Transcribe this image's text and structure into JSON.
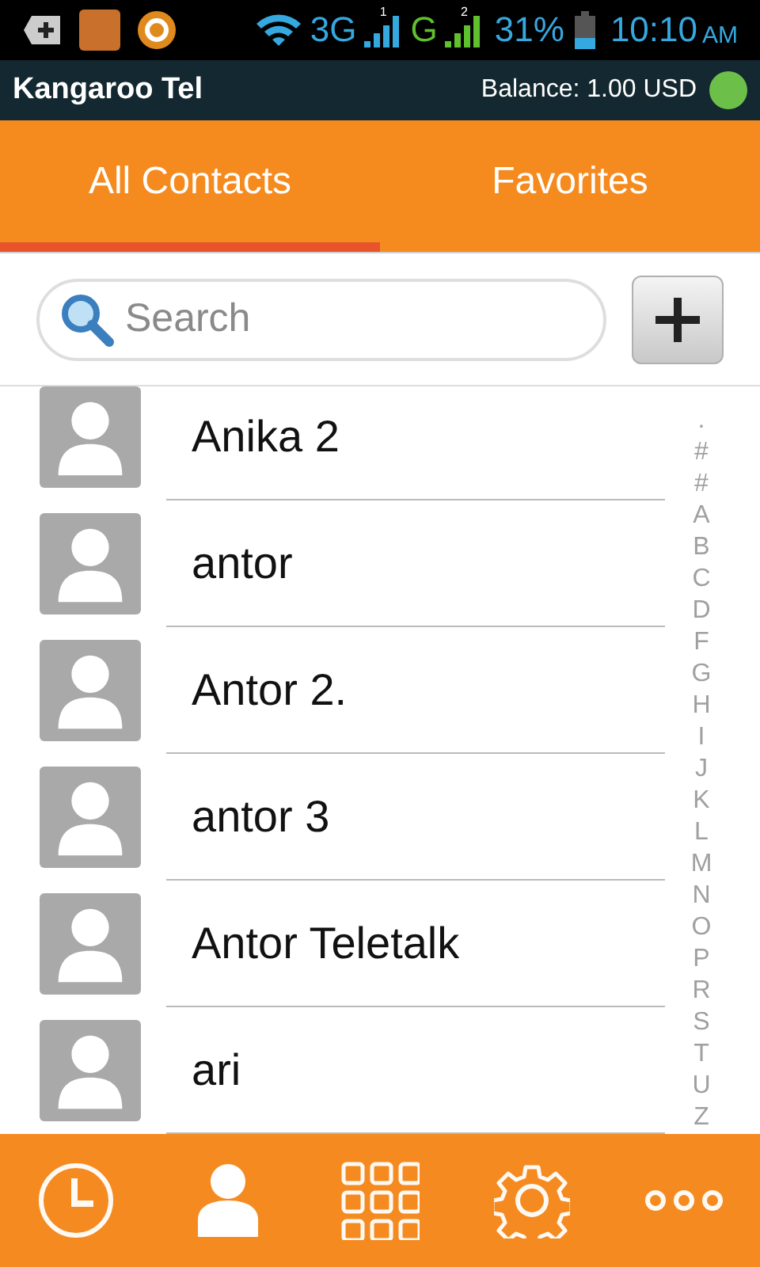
{
  "status_bar": {
    "network_1": "3G",
    "sim_1": "1",
    "network_2": "G",
    "sim_2": "2",
    "battery": "31%",
    "time": "10:10",
    "am_pm": "AM"
  },
  "app_bar": {
    "title": "Kangaroo Tel",
    "balance": "Balance: 1.00 USD",
    "online": true
  },
  "tabs": [
    {
      "label": "All Contacts",
      "selected": true
    },
    {
      "label": "Favorites",
      "selected": false
    }
  ],
  "search": {
    "placeholder": "Search"
  },
  "contacts": [
    {
      "name": "Anika 2"
    },
    {
      "name": "antor"
    },
    {
      "name": "Antor 2."
    },
    {
      "name": "antor 3"
    },
    {
      "name": "Antor Teletalk"
    },
    {
      "name": "ari"
    }
  ],
  "index_letters": [
    ".",
    "#",
    "#",
    "A",
    "B",
    "C",
    "D",
    "F",
    "G",
    "H",
    "I",
    "J",
    "K",
    "L",
    "M",
    "N",
    "O",
    "P",
    "R",
    "S",
    "T",
    "U",
    "Z"
  ],
  "bottom_nav": [
    {
      "kind": "history",
      "selected": false
    },
    {
      "kind": "contacts",
      "selected": true
    },
    {
      "kind": "dialpad",
      "selected": false
    },
    {
      "kind": "settings",
      "selected": false
    },
    {
      "kind": "more",
      "selected": false
    }
  ]
}
